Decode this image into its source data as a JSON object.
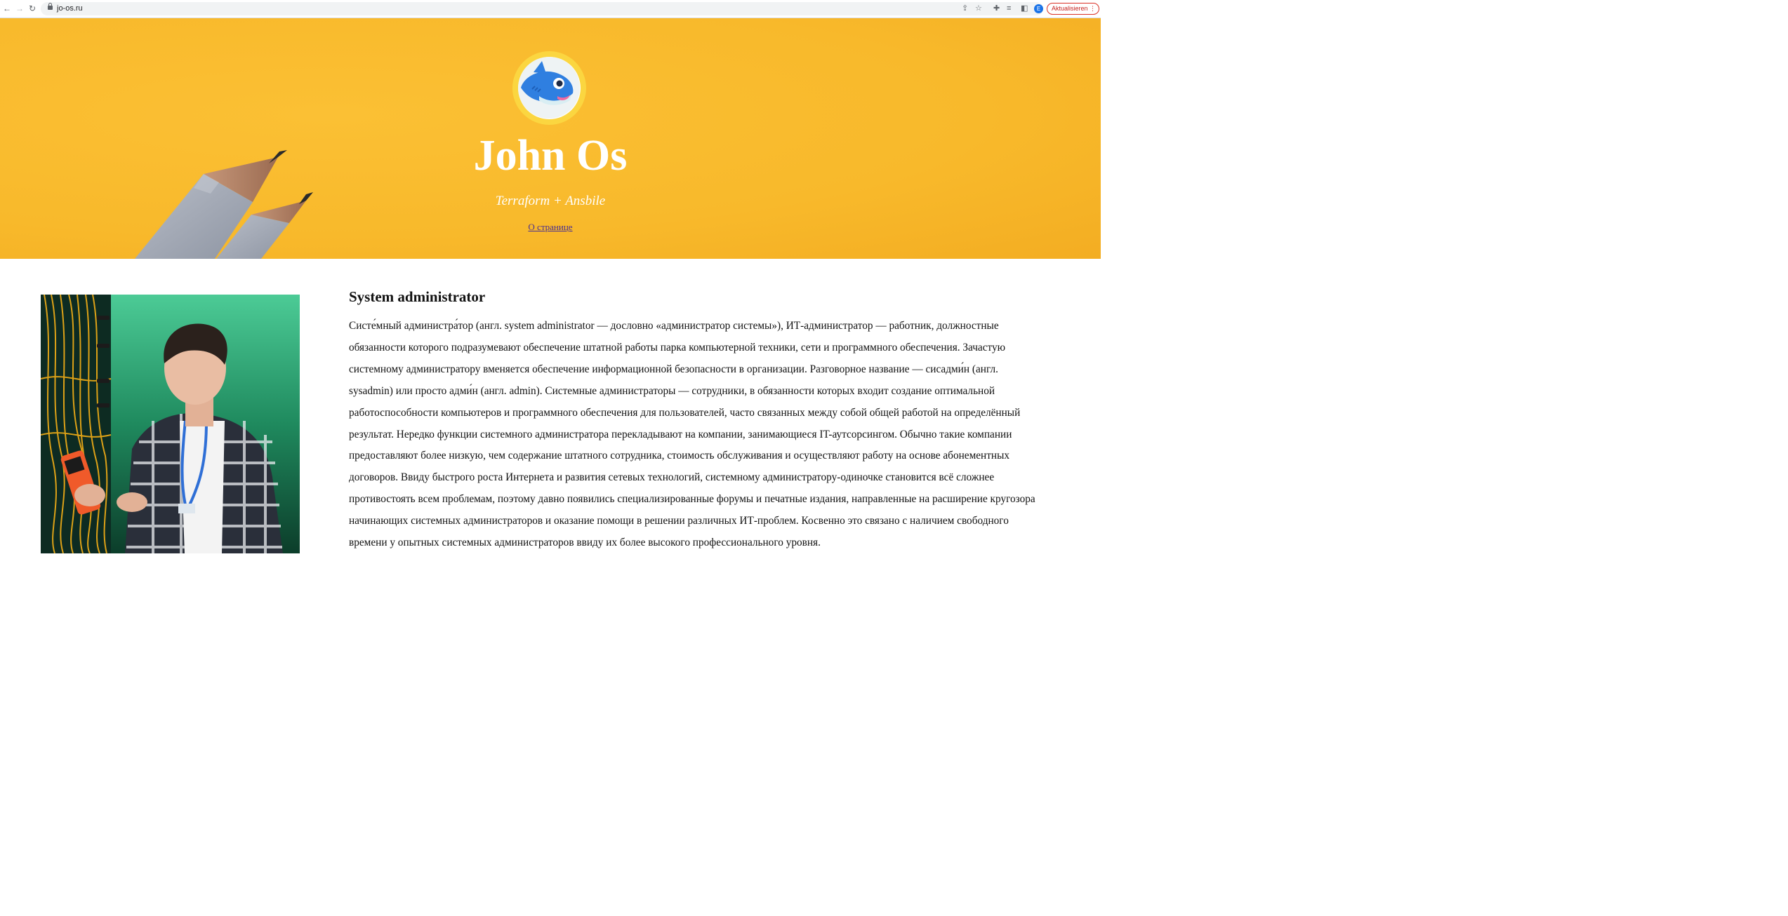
{
  "browser": {
    "url": "jo-os.ru",
    "update_button_label": "Aktualisieren",
    "profile_initial": "E",
    "accent_color": "#d93025"
  },
  "hero": {
    "title": "John Os",
    "subtitle": "Terraform + Ansbile",
    "about_link": "О странице",
    "background_color": "#f8b92b"
  },
  "article": {
    "title": "System administrator",
    "body": "Систе́мный администра́тор (англ. system administrator — дословно «администратор системы»), ИТ-администратор — работник, должностные обязанности которого подразумевают обеспечение штатной работы парка компьютерной техники, сети и программного обеспечения. Зачастую системному администратору вменяется обеспечение информационной безопасности в организации. Разговорное название — сисадми́н (англ. sysadmin) или просто адми́н (англ. admin). Системные администраторы — сотрудники, в обязанности которых входит создание оптимальной работоспособности компьютеров и программного обеспечения для пользователей, часто связанных между собой общей работой на определённый результат. Нередко функции системного администратора перекладывают на компании, занимающиеся IT-аутсорсингом. Обычно такие компании предоставляют более низкую, чем содержание штатного сотрудника, стоимость обслуживания и осуществляют работу на основе абонементных договоров. Ввиду быстрого роста Интернета и развития сетевых технологий, системному администратору-одиночке становится всё сложнее противостоять всем проблемам, поэтому давно появились специализированные форумы и печатные издания, направленные на расширение кругозора начинающих системных администраторов и оказание помощи в решении различных ИТ-проблем. Косвенно это связано с наличием свободного времени у опытных системных администраторов ввиду их более высокого профессионального уровня."
  }
}
